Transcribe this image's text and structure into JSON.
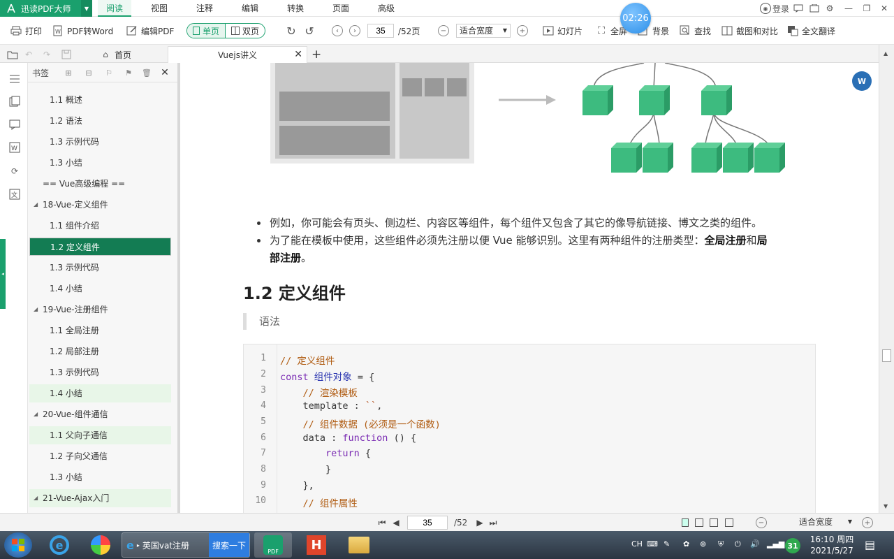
{
  "app": {
    "name": "迅读PDF大师"
  },
  "menu": {
    "items": [
      "阅读",
      "视图",
      "注释",
      "编辑",
      "转换",
      "页面",
      "高级"
    ],
    "active": "阅读"
  },
  "timer": "02:26",
  "topright": {
    "login": "登录"
  },
  "toolbar": {
    "print": "打印",
    "pdf2word": "PDF转Word",
    "editpdf": "编辑PDF",
    "single": "单页",
    "double": "双页",
    "page": "35",
    "total": "/52页",
    "zoom": "适合宽度",
    "slideshow": "幻灯片",
    "fullscreen": "全屏",
    "background": "背景",
    "find": "查找",
    "compare": "截图和对比",
    "translate": "全文翻译"
  },
  "tabs": {
    "home": "首页",
    "doc": "Vuejs讲义"
  },
  "bookmarks": {
    "title": "书签",
    "items": [
      {
        "label": "1.1 概述"
      },
      {
        "label": "1.2 语法"
      },
      {
        "label": "1.3 示例代码"
      },
      {
        "label": "1.3 小结"
      },
      {
        "label": "== Vue高级编程 =="
      },
      {
        "label": "18-Vue-定义组件"
      },
      {
        "label": "1.1 组件介绍"
      },
      {
        "label": "1.2 定义组件"
      },
      {
        "label": "1.3 示例代码"
      },
      {
        "label": "1.4 小结"
      },
      {
        "label": "19-Vue-注册组件"
      },
      {
        "label": "1.1 全局注册"
      },
      {
        "label": "1.2 局部注册"
      },
      {
        "label": "1.3 示例代码"
      },
      {
        "label": "1.4 小结"
      },
      {
        "label": "20-Vue-组件通信"
      },
      {
        "label": "1.1 父向子通信"
      },
      {
        "label": "1.2 子向父通信"
      },
      {
        "label": "1.3 小结"
      },
      {
        "label": "21-Vue-Ajax入门"
      }
    ]
  },
  "content": {
    "bullet1": "例如，你可能会有页头、侧边栏、内容区等组件，每个组件又包含了其它的像导航链接、博文之类的组件。",
    "bullet2_pre": "为了能在模板中使用，这些组件必须先注册以便 Vue 能够识别。这里有两种组件的注册类型：",
    "bullet2_b1": "全局注册",
    "bullet2_mid": "和",
    "bullet2_b2": "局",
    "bullet2_line2": "部注册",
    "bullet2_end": "。",
    "heading": "1.2 定义组件",
    "quote": "语法",
    "code": {
      "line_numbers": [
        "1",
        "2",
        "3",
        "4",
        "5",
        "6",
        "7",
        "8",
        "9",
        "10"
      ],
      "l1": "// 定义组件",
      "l2_kw": "const ",
      "l2_id": "组件对象",
      "l2_rest": " = {",
      "l3": "    // 渲染模板",
      "l4_a": "    template : ",
      "l4_s": "``",
      "l4_b": ",",
      "l5": "    // 组件数据 (必须是一个函数)",
      "l6_a": "    data : ",
      "l6_kw": "function",
      "l6_b": " () {",
      "l7_kw": "        return",
      "l7_b": " {",
      "l8": "        }",
      "l9": "    },",
      "l10": "    // 组件属性"
    }
  },
  "bottom": {
    "page": "35",
    "total": "/52",
    "zoom": "适合宽度"
  },
  "taskbar": {
    "ie_title": "英国vat注册",
    "search": "搜索一下",
    "pdf_label": "PDF",
    "lang": "CH",
    "time": "16:10 周四",
    "date": "2021/5/27",
    "badge": "31"
  }
}
